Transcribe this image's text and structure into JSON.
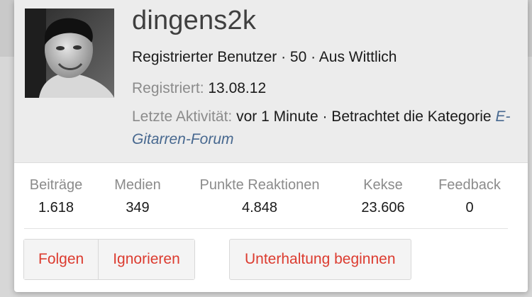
{
  "profile": {
    "username": "dingens2k",
    "avatar_icon": "user-photo",
    "title_line": "Registrierter Benutzer · 50 · Aus Wittlich",
    "registered_label": "Registriert:",
    "registered_value": "13.08.12",
    "activity_label": "Letzte Aktivität:",
    "activity_value": "vor 1 Minute · Betrachtet die Kategorie",
    "activity_link": "E-Gitarren-Forum"
  },
  "stats": [
    {
      "label": "Beiträge",
      "value": "1.618"
    },
    {
      "label": "Medien",
      "value": "349"
    },
    {
      "label": "Punkte Reaktionen",
      "value": "4.848"
    },
    {
      "label": "Kekse",
      "value": "23.606"
    },
    {
      "label": "Feedback",
      "value": "0"
    }
  ],
  "actions": {
    "follow": "Folgen",
    "ignore": "Ignorieren",
    "conversation": "Unterhaltung beginnen"
  },
  "colors": {
    "accent": "#dc3b2f",
    "link": "#47688f",
    "muted": "#8b8b8b"
  }
}
